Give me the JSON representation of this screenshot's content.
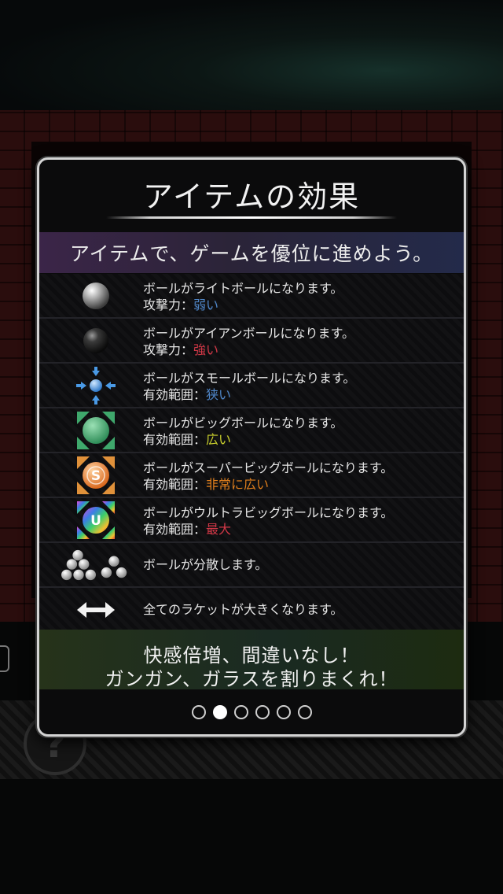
{
  "dialog": {
    "title": "アイテムの効果",
    "subtitle": "アイテムで、ゲームを優位に進めよう。",
    "items": [
      {
        "icon": "light-ball-icon",
        "line1": "ボールがライトボールになります。",
        "label": "攻撃力：",
        "value": "弱い",
        "value_color": "#4f86c8"
      },
      {
        "icon": "iron-ball-icon",
        "line1": "ボールがアイアンボールになります。",
        "label": "攻撃力：",
        "value": "強い",
        "value_color": "#d23847"
      },
      {
        "icon": "small-ball-icon",
        "line1": "ボールがスモールボールになります。",
        "label": "有効範囲：",
        "value": "狭い",
        "value_color": "#4f86c8"
      },
      {
        "icon": "big-ball-icon",
        "line1": "ボールがビッグボールになります。",
        "label": "有効範囲：",
        "value": "広い",
        "value_color": "#c9cf2d"
      },
      {
        "icon": "super-big-ball-icon",
        "icon_letter": "S",
        "line1": "ボールがスーパービッグボールになります。",
        "label": "有効範囲：",
        "value": "非常に広い",
        "value_color": "#e07f1d"
      },
      {
        "icon": "ultra-big-ball-icon",
        "icon_letter": "U",
        "line1": "ボールがウルトラビッグボールになります。",
        "label": "有効範囲：",
        "value": "最大",
        "value_color": "#d23847"
      },
      {
        "icon": "multi-ball-icon",
        "line1": "ボールが分散します。"
      },
      {
        "icon": "wide-racket-icon",
        "line1": "全てのラケットが大きくなります。"
      }
    ],
    "footer": {
      "line1": "快感倍増、間違いなし！",
      "line2": "ガンガン、ガラスを割りまくれ！"
    },
    "pagination": {
      "pages": 6,
      "current": 2
    }
  },
  "help_button": {
    "symbol": "?"
  }
}
